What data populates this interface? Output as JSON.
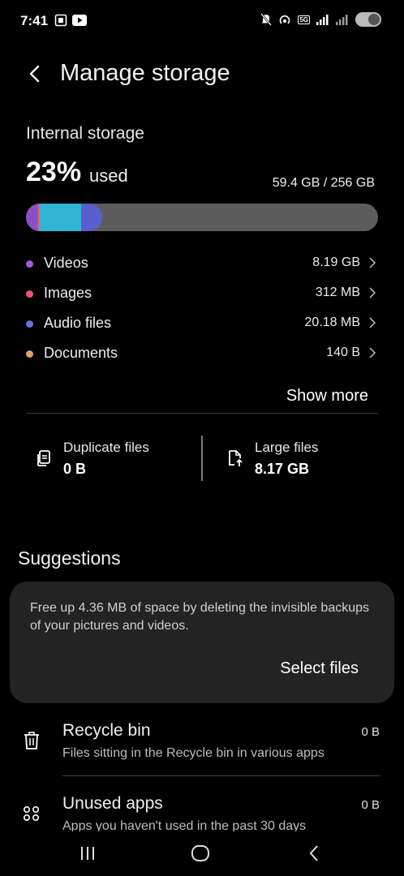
{
  "status_bar": {
    "time": "7:41",
    "left_icons": [
      "screen-record-icon",
      "youtube-icon"
    ],
    "right_icons": [
      "mute-icon",
      "hotspot-icon",
      "5g-icon",
      "signal-icon",
      "signal-r-icon",
      "toggle-icon"
    ],
    "network_label": "5G"
  },
  "header": {
    "title": "Manage storage",
    "back_icon": "back-arrow-icon"
  },
  "storage": {
    "section_title": "Internal storage",
    "percent": "23%",
    "percent_suffix": "used",
    "used_total": "59.4 GB / 256 GB",
    "bar_fraction_used": 0.23,
    "segments": [
      {
        "name": "videos",
        "color": "#8a4fc4"
      },
      {
        "name": "images",
        "color": "#e0506a"
      },
      {
        "name": "other",
        "color": "#2fb4d1"
      },
      {
        "name": "audio",
        "color": "#5a5fcf"
      }
    ],
    "categories": [
      {
        "label": "Videos",
        "size": "8.19 GB",
        "color": "#a45bd8"
      },
      {
        "label": "Images",
        "size": "312 MB",
        "color": "#e8556e"
      },
      {
        "label": "Audio files",
        "size": "20.18 MB",
        "color": "#6d6ee0"
      },
      {
        "label": "Documents",
        "size": "140 B",
        "color": "#e0a26a"
      }
    ],
    "show_more_label": "Show more"
  },
  "tiles": [
    {
      "label": "Duplicate files",
      "value": "0 B",
      "icon": "duplicate-files-icon"
    },
    {
      "label": "Large files",
      "value": "8.17 GB",
      "icon": "large-files-icon"
    }
  ],
  "suggestions": {
    "title": "Suggestions",
    "card_text": "Free up 4.36 MB of space by deleting the invisible backups of your pictures and videos.",
    "card_button": "Select files"
  },
  "list": [
    {
      "title": "Recycle bin",
      "subtitle": "Files sitting in the Recycle bin in various apps",
      "value": "0 B",
      "icon": "trash-icon"
    },
    {
      "title": "Unused apps",
      "subtitle": "Apps you haven't used in the past 30 days",
      "value": "0 B",
      "icon": "apps-grid-icon"
    }
  ],
  "nav_bar": {
    "buttons": [
      "recents-icon",
      "home-icon",
      "back-icon"
    ]
  }
}
